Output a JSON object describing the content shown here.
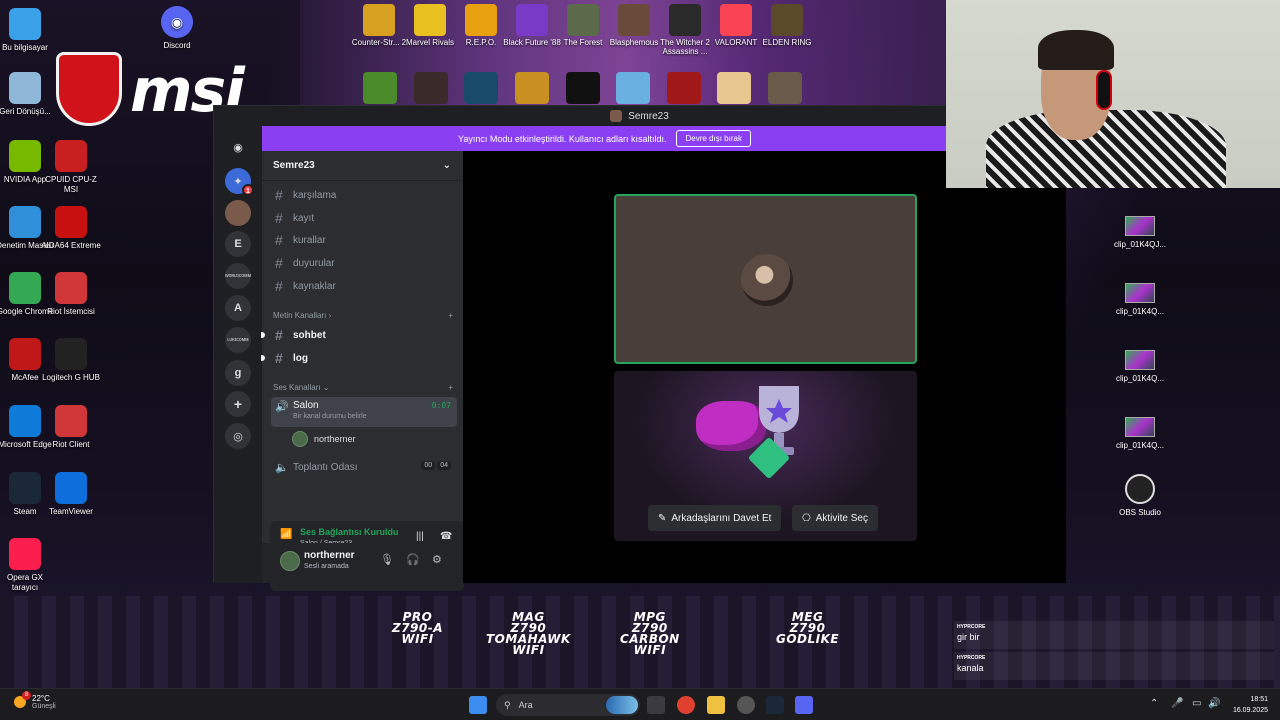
{
  "desktop_left_icons": [
    {
      "label": "Bu bilgisayar",
      "icon": "computer-icon",
      "color": "#3aa0e8"
    },
    {
      "label": "Geri Dönüşü...",
      "icon": "recycle-bin-icon",
      "color": "#8fb8d8"
    },
    {
      "label": "NVIDIA App",
      "icon": "nvidia-icon",
      "color": "#76b900"
    },
    {
      "label": "CPUID CPU-Z MSI",
      "icon": "cpuz-icon",
      "color": "#c82020"
    },
    {
      "label": "Denetim Masası",
      "icon": "control-panel-icon",
      "color": "#2f8fd8"
    },
    {
      "label": "AIDA64 Extreme",
      "icon": "aida64-icon",
      "color": "#c81010"
    },
    {
      "label": "Google Chrome",
      "icon": "chrome-icon",
      "color": "#34a853"
    },
    {
      "label": "Riot İstemcisi",
      "icon": "riot-icon",
      "color": "#d13639"
    },
    {
      "label": "McAfee",
      "icon": "mcafee-icon",
      "color": "#c01818"
    },
    {
      "label": "Logitech G HUB",
      "icon": "logitech-icon",
      "color": "#222222"
    },
    {
      "label": "Microsoft Edge",
      "icon": "edge-icon",
      "color": "#0f7bd8"
    },
    {
      "label": "Riot Client",
      "icon": "riot-client-icon",
      "color": "#d13639"
    },
    {
      "label": "Steam",
      "icon": "steam-icon",
      "color": "#1b2838"
    },
    {
      "label": "TeamViewer",
      "icon": "teamviewer-icon",
      "color": "#0e6edb"
    },
    {
      "label": "Opera GX tarayıcı",
      "icon": "opera-gx-icon",
      "color": "#fa1e4e"
    }
  ],
  "discord_desktop": {
    "label": "Discord",
    "icon": "discord-icon",
    "color": "#5865f2"
  },
  "top_games": [
    {
      "label": "Counter-Str... 2",
      "color": "#d8a020"
    },
    {
      "label": "Marvel Rivals",
      "color": "#e8c020"
    },
    {
      "label": "R.E.P.O.",
      "color": "#e8a010"
    },
    {
      "label": "Black Future '88",
      "color": "#7a3ac8"
    },
    {
      "label": "The Forest",
      "color": "#5a6a4a"
    },
    {
      "label": "Blasphemous",
      "color": "#6a4a3a"
    },
    {
      "label": "The Witcher 2 Assassins ...",
      "color": "#2a2a2a"
    },
    {
      "label": "VALORANT",
      "color": "#fa4454"
    },
    {
      "label": "ELDEN RING",
      "color": "#5a4a2a"
    }
  ],
  "brand": {
    "logo_text": "msi"
  },
  "board_labels": [
    {
      "l1": "PRO",
      "l2": "Z790-A",
      "l3": "WIFI"
    },
    {
      "l1": "MAG",
      "l2": "Z790",
      "l3": "TOMAHAWK",
      "l4": "WIFI"
    },
    {
      "l1": "MPG",
      "l2": "Z790",
      "l3": "CARBON",
      "l4": "WIFI"
    },
    {
      "l1": "MEG",
      "l2": "Z790",
      "l3": "GODLIKE"
    }
  ],
  "clips": [
    {
      "label": "clip_01K4QJ..."
    },
    {
      "label": "clip_01K4Q..."
    },
    {
      "label": "clip_01K4Q..."
    },
    {
      "label": "clip_01K4Q..."
    }
  ],
  "obs": {
    "label": "OBS Studio"
  },
  "discord": {
    "window_title": "Semre23",
    "banner_text": "Yayıncı Modu etkinleştirildi. Kullanıcı adları kısaltıldı.",
    "banner_button": "Devre dışı bırak",
    "server_name": "Semre23",
    "guild_letters": {
      "e": "E",
      "a": "A",
      "g": "g",
      "long1": "ᴡᴏʀʟᴅᴄᴏᴍᴍ",
      "long2": "ʟᴜᴋɪᴄᴏᴍᴍ"
    },
    "guild_badge": "1",
    "channels_top": [
      "karşılama",
      "kayıt",
      "kurallar",
      "duyurular",
      "kaynaklar"
    ],
    "text_category": "Metin Kanalları",
    "text_channels": [
      "sohbet",
      "log"
    ],
    "voice_category": "Ses Kanalları",
    "active_voice": {
      "name": "Salon",
      "status": "Bir kanal durumu belirle",
      "timer": "0:07"
    },
    "voice_user": "northerner",
    "other_voice": {
      "name": "Toplantı Odası",
      "count1": "00",
      "count2": "04"
    },
    "voice_panel": {
      "status": "Ses Bağlantısı Kuruldu",
      "sub": "Salon / Semre23"
    },
    "user": {
      "name": "northerner",
      "status": "Sesli aramada"
    },
    "invite_button": "Arkadaşlarını Davet Et",
    "activity_button": "Aktivite Seç"
  },
  "chat": [
    {
      "from": "HYPRCORE",
      "msg": "gir bir"
    },
    {
      "from": "HYPRCORE",
      "msg": "kanala"
    }
  ],
  "taskbar": {
    "weather_temp": "22°C",
    "weather_desc": "Güneşli",
    "weather_badge": "8",
    "search_placeholder": "Ara",
    "time": "18:51",
    "date": "16.09.2025"
  }
}
